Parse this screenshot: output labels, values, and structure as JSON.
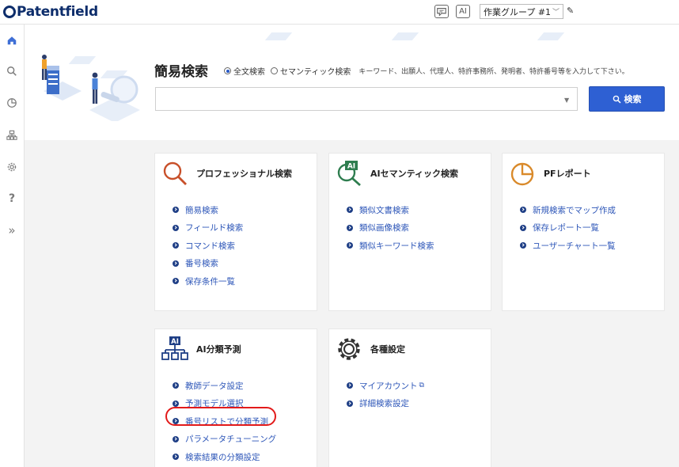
{
  "header": {
    "logo_text": "Patentfield",
    "chat_icon": "chat-bubble-icon",
    "ai_icon_label": "AI",
    "group_select_value": "作業グループ #1"
  },
  "sidebar": {
    "items": [
      {
        "name": "home-icon"
      },
      {
        "name": "search-icon"
      },
      {
        "name": "pie-chart-icon"
      },
      {
        "name": "org-chart-icon"
      },
      {
        "name": "gear-icon"
      },
      {
        "name": "help-icon",
        "glyph": "?"
      },
      {
        "name": "expand-icon",
        "glyph": "»"
      }
    ]
  },
  "search": {
    "title": "簡易検索",
    "radio_fulltext": "全文検索",
    "radio_semantic": "セマンティック検索",
    "hint": "キーワード、出願人、代理人、特許事務所、発明者、特許番号等を入力して下さい。",
    "input_value": "",
    "button_label": "検索"
  },
  "cards": {
    "professional": {
      "title": "プロフェッショナル検索",
      "links": [
        "簡易検索",
        "フィールド検索",
        "コマンド検索",
        "番号検索",
        "保存条件一覧"
      ]
    },
    "ai_semantic": {
      "title": "AIセマンティック検索",
      "icon_badge": "AI",
      "links": [
        "類似文書検索",
        "類似画像検索",
        "類似キーワード検索"
      ]
    },
    "pf_report": {
      "title": "PFレポート",
      "links": [
        "新規検索でマップ作成",
        "保存レポート一覧",
        "ユーザーチャート一覧"
      ]
    },
    "ai_classify": {
      "title": "AI分類予測",
      "icon_badge": "AI",
      "links": [
        "教師データ設定",
        "予測モデル選択",
        "番号リストで分類予測",
        "パラメータチューニング",
        "検索結果の分類設定"
      ]
    },
    "settings": {
      "title": "各種設定",
      "links": [
        "マイアカウント",
        "詳細検索設定"
      ]
    }
  },
  "colors": {
    "brand": "#0d2d6b",
    "accent": "#2e60d3",
    "link": "#2d56b8",
    "highlight": "#e21a1a",
    "pro_icon": "#c8502a",
    "semantic_icon": "#2e7d4f",
    "report_icon": "#d98a2b"
  }
}
